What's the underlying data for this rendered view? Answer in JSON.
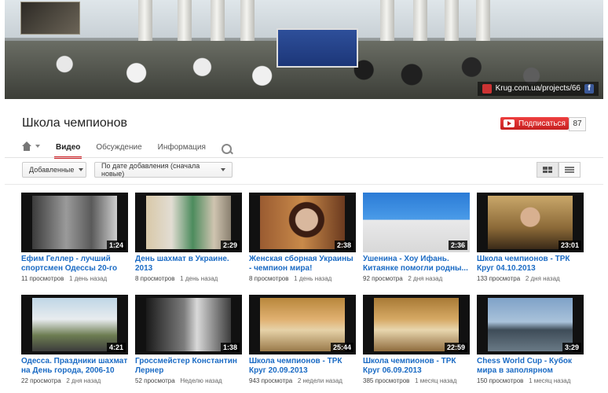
{
  "banner": {
    "link_text": "Krug.com.ua/projects/66",
    "facebook_glyph": "f",
    "icons": [
      "krug-site-icon",
      "facebook-icon"
    ]
  },
  "channel": {
    "title": "Школа чемпионов",
    "subscribe_label": "Подписаться",
    "subscriber_count": "87"
  },
  "tabs": [
    {
      "label": "Видео",
      "active": true
    },
    {
      "label": "Обсуждение",
      "active": false
    },
    {
      "label": "Информация",
      "active": false
    }
  ],
  "filters": {
    "type": "Добавленные",
    "sort": "По дате добавления (сначала новые)",
    "view_mode": "grid"
  },
  "colors": {
    "accent": "#cc181e",
    "link": "#1b6bc4",
    "subscribe": "#e62117"
  },
  "videos": [
    {
      "title": "Ефим Геллер - лучший спортсмен Одессы 20-го в...",
      "duration": "1:24",
      "views": "11 просмотров",
      "age": "1 день назад"
    },
    {
      "title": "День шахмат в Украине. 2013",
      "duration": "2:29",
      "views": "8 просмотров",
      "age": "1 день назад"
    },
    {
      "title": "Женская сборная Украины - чемпион мира!",
      "duration": "2:38",
      "views": "8 просмотров",
      "age": "1 день назад"
    },
    {
      "title": "Ушенина - Хоу Ифань. Китаянке помогли родны...",
      "duration": "2:36",
      "views": "92 просмотра",
      "age": "2 дня назад"
    },
    {
      "title": "Школа чемпионов - ТРК Круг 04.10.2013",
      "duration": "23:01",
      "views": "133 просмотра",
      "age": "2 дня назад"
    },
    {
      "title": "Одесса. Праздники шахмат на День города, 2006-10",
      "duration": "4:21",
      "views": "22 просмотра",
      "age": "2 дня назад"
    },
    {
      "title": "Гроссмейстер Константин Лернер",
      "duration": "1:38",
      "views": "52 просмотра",
      "age": "Неделю назад"
    },
    {
      "title": "Школа чемпионов - ТРК Круг 20.09.2013",
      "duration": "25:44",
      "views": "943 просмотра",
      "age": "2 недели назад"
    },
    {
      "title": "Школа чемпионов - ТРК Круг 06.09.2013",
      "duration": "22:59",
      "views": "385 просмотров",
      "age": "1 месяц назад"
    },
    {
      "title": "Chess World Cup - Кубок мира в заполярном Тромс...",
      "duration": "3:29",
      "views": "150 просмотров",
      "age": "1 месяц назад"
    }
  ]
}
